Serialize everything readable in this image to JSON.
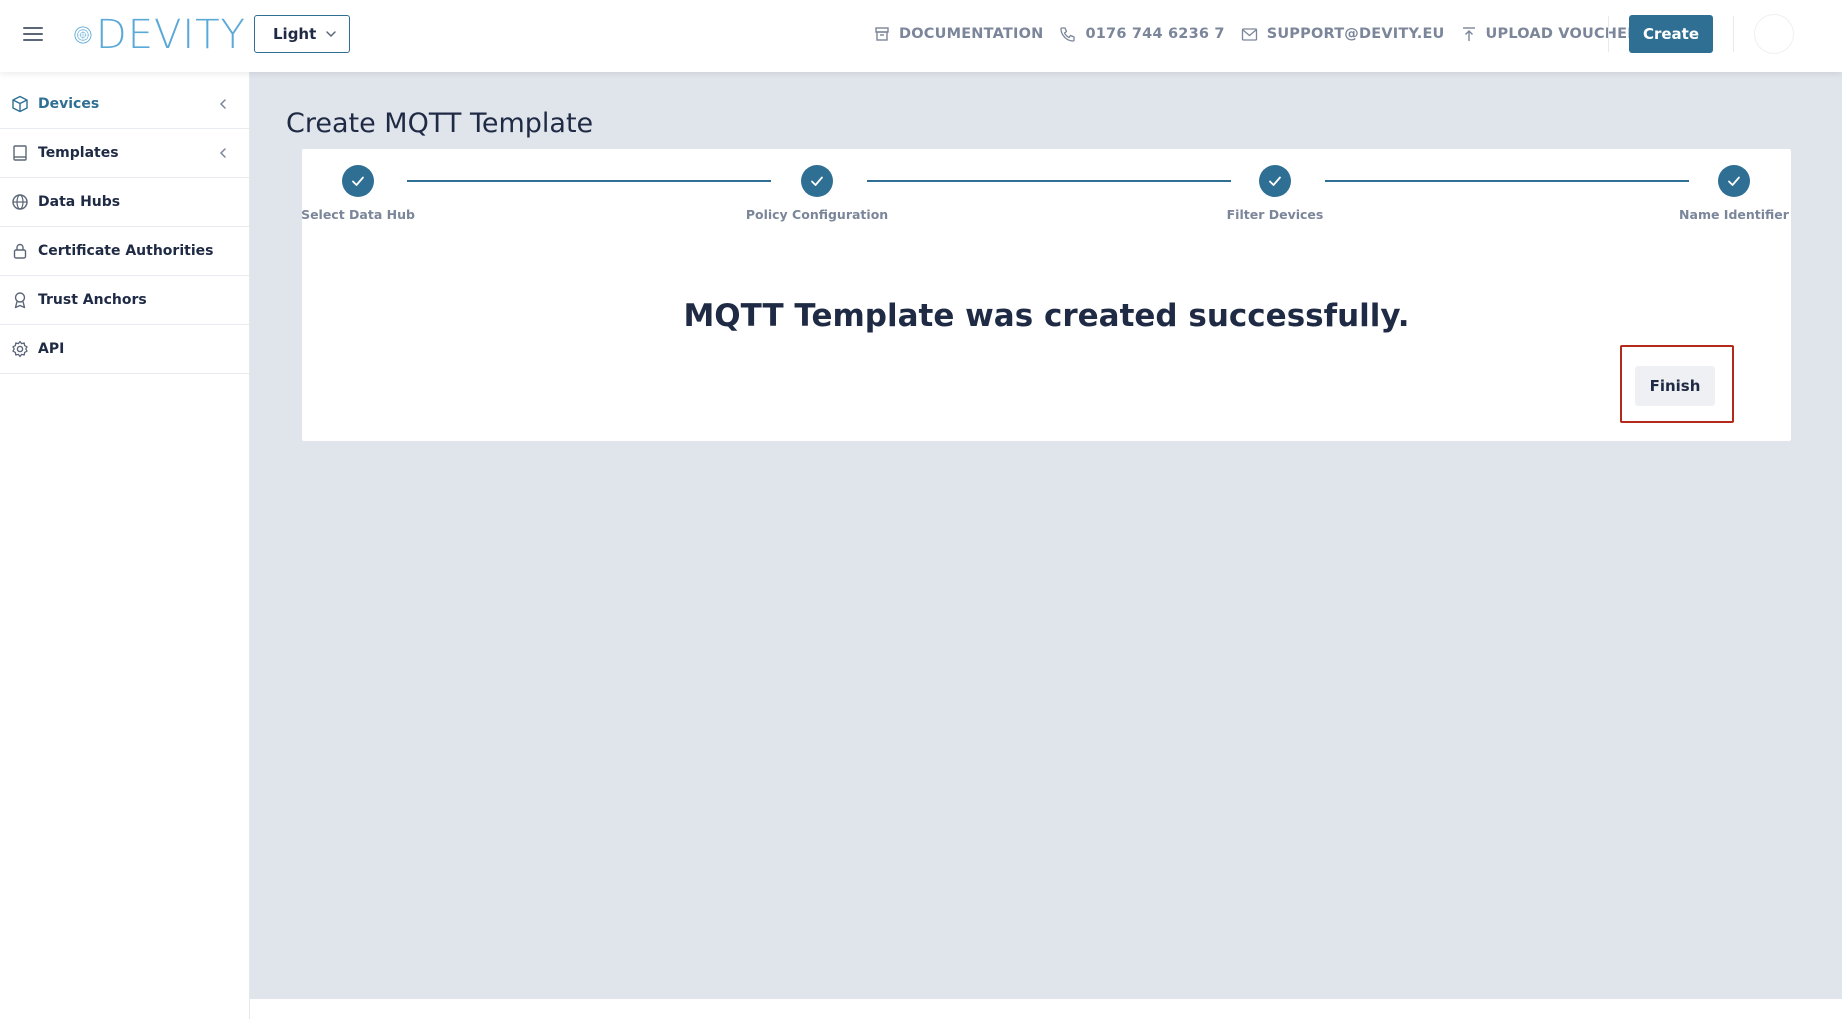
{
  "header": {
    "logo_text": "DEVITY",
    "theme_select": {
      "value": "Light"
    },
    "links": [
      {
        "label": "DOCUMENTATION",
        "icon": "archive-icon"
      },
      {
        "label": "0176 744 6236 7",
        "icon": "phone-icon"
      },
      {
        "label": "SUPPORT@DEVITY.EU",
        "icon": "mail-icon"
      },
      {
        "label": "UPLOAD VOUCHER",
        "icon": "upload-icon"
      }
    ],
    "create_label": "Create"
  },
  "sidebar": {
    "items": [
      {
        "label": "Devices",
        "icon": "cube-icon",
        "active": true,
        "has_caret": true
      },
      {
        "label": "Templates",
        "icon": "book-icon",
        "active": false,
        "has_caret": true
      },
      {
        "label": "Data Hubs",
        "icon": "globe-icon",
        "active": false,
        "has_caret": false
      },
      {
        "label": "Certificate Authorities",
        "icon": "lock-icon",
        "active": false,
        "has_caret": false
      },
      {
        "label": "Trust Anchors",
        "icon": "award-icon",
        "active": false,
        "has_caret": false
      },
      {
        "label": "API",
        "icon": "gear-icon",
        "active": false,
        "has_caret": false
      }
    ]
  },
  "main": {
    "title": "Create MQTT Template",
    "steps": [
      {
        "label": "Select Data Hub",
        "completed": true
      },
      {
        "label": "Policy Configuration",
        "completed": true
      },
      {
        "label": "Filter Devices",
        "completed": true
      },
      {
        "label": "Name Identifier",
        "completed": true
      }
    ],
    "success_message": "MQTT Template was created successfully.",
    "finish_label": "Finish"
  },
  "colors": {
    "accent": "#2f6f94",
    "logo": "#5aa9d6",
    "background": "#e0e4eb",
    "highlight_box": "#b22a1a",
    "muted_text": "#7b869a"
  }
}
